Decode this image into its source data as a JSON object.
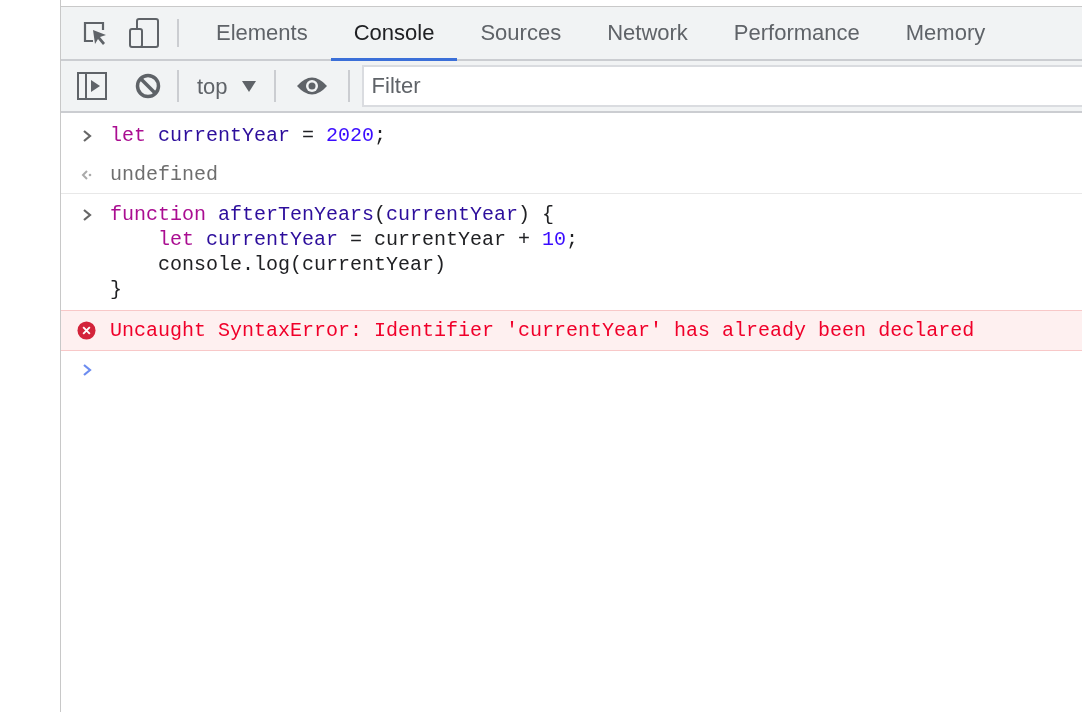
{
  "tabs": [
    {
      "label": "Elements",
      "selected": false
    },
    {
      "label": "Console",
      "selected": true
    },
    {
      "label": "Sources",
      "selected": false
    },
    {
      "label": "Network",
      "selected": false
    },
    {
      "label": "Performance",
      "selected": false
    },
    {
      "label": "Memory",
      "selected": false
    }
  ],
  "toolbar": {
    "context": "top",
    "filter": {
      "placeholder": "Filter"
    }
  },
  "console": [
    {
      "kind": "input",
      "lines": [
        [
          {
            "kind": "keyword",
            "text": "let "
          },
          {
            "kind": "name",
            "text": "currentYear"
          },
          {
            "kind": "plain",
            "text": " = "
          },
          {
            "kind": "number",
            "text": "2020"
          },
          {
            "kind": "plain",
            "text": ";"
          }
        ]
      ]
    },
    {
      "kind": "result",
      "text": "undefined"
    },
    {
      "kind": "input",
      "lines": [
        [
          {
            "kind": "keyword",
            "text": "function "
          },
          {
            "kind": "name",
            "text": "afterTenYears"
          },
          {
            "kind": "plain",
            "text": "("
          },
          {
            "kind": "name",
            "text": "currentYear"
          },
          {
            "kind": "plain",
            "text": ") {"
          }
        ],
        [
          {
            "kind": "keyword",
            "text": "    let "
          },
          {
            "kind": "name",
            "text": "currentYear"
          },
          {
            "kind": "plain",
            "text": " = currentYear + "
          },
          {
            "kind": "number",
            "text": "10"
          },
          {
            "kind": "plain",
            "text": ";"
          }
        ],
        [
          {
            "kind": "plain",
            "text": "    console.log(currentYear)"
          }
        ],
        [
          {
            "kind": "plain",
            "text": "}"
          }
        ]
      ]
    },
    {
      "kind": "error",
      "text": "Uncaught SyntaxError: Identifier 'currentYear' has already been declared"
    }
  ]
}
